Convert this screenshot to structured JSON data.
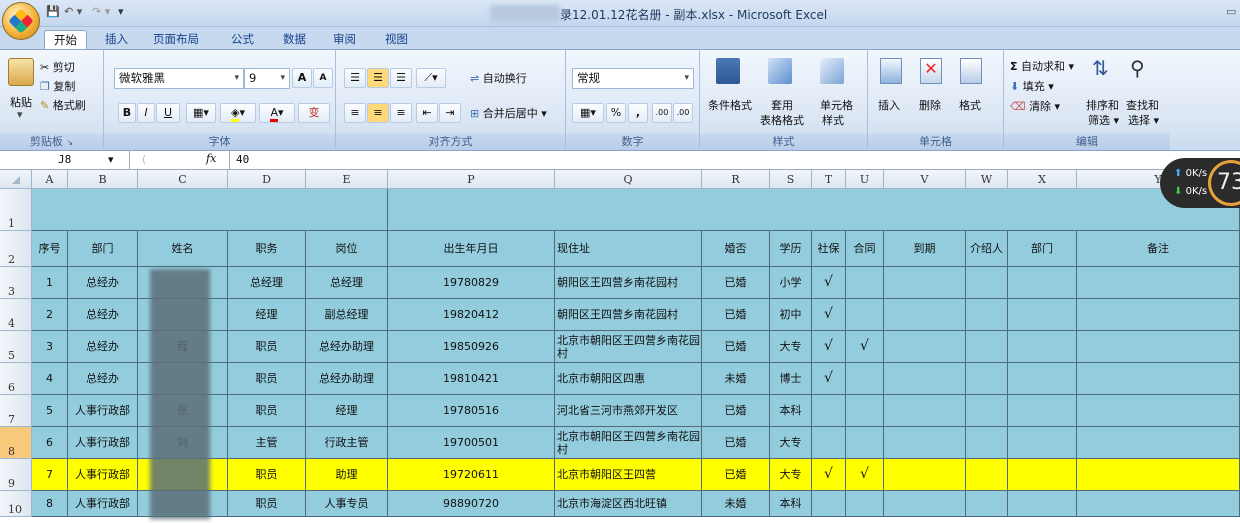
{
  "window": {
    "title": "录12.01.12花名册 - 副本.xlsx - Microsoft Excel"
  },
  "tabs": [
    "开始",
    "插入",
    "页面布局",
    "公式",
    "数据",
    "审阅",
    "视图"
  ],
  "clipboard": {
    "paste": "粘贴",
    "cut": "剪切",
    "copy": "复制",
    "painter": "格式刷",
    "label": "剪贴板"
  },
  "font": {
    "name": "微软雅黑",
    "size": "9",
    "label": "字体",
    "bold": "B",
    "italic": "I",
    "underline": "U",
    "grow": "A",
    "shrink": "A",
    "color_letter": "A",
    "wen": "变"
  },
  "align": {
    "wrap": "自动换行",
    "merge": "合并后居中",
    "label": "对齐方式"
  },
  "number": {
    "format": "常规",
    "percent": "%",
    "comma": ",",
    "inc": ".00",
    "dec": ".00",
    "label": "数字"
  },
  "styles": {
    "cond": "条件格式",
    "table": "套用",
    "table2": "表格格式",
    "cell": "单元格",
    "cell2": "样式",
    "label": "样式"
  },
  "cells": {
    "insert": "插入",
    "delete": "删除",
    "format": "格式",
    "label": "单元格"
  },
  "editing": {
    "autosum": "自动求和",
    "fill": "填充",
    "clear": "清除",
    "sort": "排序和",
    "sort2": "筛选",
    "find": "查找和",
    "find2": "选择",
    "label": "编辑"
  },
  "formula": {
    "namebox": "J8",
    "fx": "fx",
    "value": "40"
  },
  "network": {
    "up": "0K/s",
    "down": "0K/s",
    "percent": "73"
  },
  "colors": {
    "cell_bg": "#93cddd",
    "highlight": "#ffff00",
    "header_bg": "#dde6f0"
  },
  "columns": [
    "A",
    "B",
    "C",
    "D",
    "E",
    "P",
    "Q",
    "R",
    "S",
    "T",
    "U",
    "V",
    "W",
    "X",
    "Y"
  ],
  "row_numbers": [
    "1",
    "2",
    "3",
    "4",
    "5",
    "6",
    "7",
    "8",
    "9",
    "10"
  ],
  "headers": [
    "序号",
    "部门",
    "姓名",
    "职务",
    "岗位",
    "出生年月日",
    "现住址",
    "婚否",
    "学历",
    "社保",
    "合同",
    "到期",
    "介绍人",
    "部门",
    "备注"
  ],
  "rows": [
    [
      "1",
      "总经办",
      "",
      "总经理",
      "总经理",
      "19780829",
      "朝阳区王四营乡南花园村",
      "已婚",
      "小学",
      "√",
      "",
      "",
      "",
      "",
      ""
    ],
    [
      "2",
      "总经办",
      "",
      "经理",
      "副总经理",
      "19820412",
      "朝阳区王四营乡南花园村",
      "已婚",
      "初中",
      "√",
      "",
      "",
      "",
      "",
      ""
    ],
    [
      "3",
      "总经办",
      "程",
      "职员",
      "总经办助理",
      "19850926",
      "北京市朝阳区王四营乡南花园村",
      "已婚",
      "大专",
      "√",
      "√",
      "",
      "",
      "",
      ""
    ],
    [
      "4",
      "总经办",
      "",
      "职员",
      "总经办助理",
      "19810421",
      "北京市朝阳区四惠",
      "未婚",
      "博士",
      "√",
      "",
      "",
      "",
      "",
      ""
    ],
    [
      "5",
      "人事行政部",
      "张",
      "职员",
      "经理",
      "19780516",
      "河北省三河市燕郊开发区",
      "已婚",
      "本科",
      "",
      "",
      "",
      "",
      "",
      ""
    ],
    [
      "6",
      "人事行政部",
      "刘",
      "主管",
      "行政主管",
      "19700501",
      "北京市朝阳区王四营乡南花园村",
      "已婚",
      "大专",
      "",
      "",
      "",
      "",
      "",
      ""
    ],
    [
      "7",
      "人事行政部",
      "",
      "职员",
      "助理",
      "19720611",
      "北京市朝阳区王四营",
      "已婚",
      "大专",
      "√",
      "√",
      "",
      "",
      "",
      ""
    ],
    [
      "8",
      "人事行政部",
      "",
      "职员",
      "人事专员",
      "98890720",
      "北京市海淀区西北旺镇",
      "未婚",
      "本科",
      "",
      "",
      "",
      "",
      "",
      ""
    ]
  ]
}
